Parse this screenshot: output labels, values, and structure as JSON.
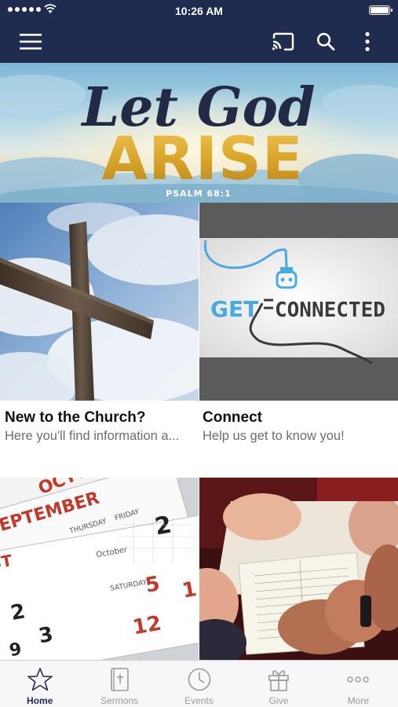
{
  "status_bar": {
    "time": "10:26 AM"
  },
  "hero": {
    "line1": "Let God",
    "line2": "ARISE",
    "reference": "PSALM 68:1"
  },
  "tiles": [
    {
      "title": "New to the Church?",
      "subtitle": "Here you'll find information a..."
    },
    {
      "title": "Connect",
      "subtitle": "Help us get to know you!",
      "image_text_1": "GET",
      "image_text_2": "CONNECTED"
    }
  ],
  "tabs": [
    {
      "label": "Home",
      "icon": "star-icon",
      "active": true
    },
    {
      "label": "Sermons",
      "icon": "bible-icon",
      "active": false
    },
    {
      "label": "Events",
      "icon": "clock-icon",
      "active": false
    },
    {
      "label": "Give",
      "icon": "gift-icon",
      "active": false
    },
    {
      "label": "More",
      "icon": "more-dots-icon",
      "active": false
    }
  ],
  "colors": {
    "nav_bg": "#1f2b4f",
    "tab_active": "#1f2b4f",
    "tab_inactive": "#9a9a9f",
    "hero_gold": "#d9a62a"
  }
}
